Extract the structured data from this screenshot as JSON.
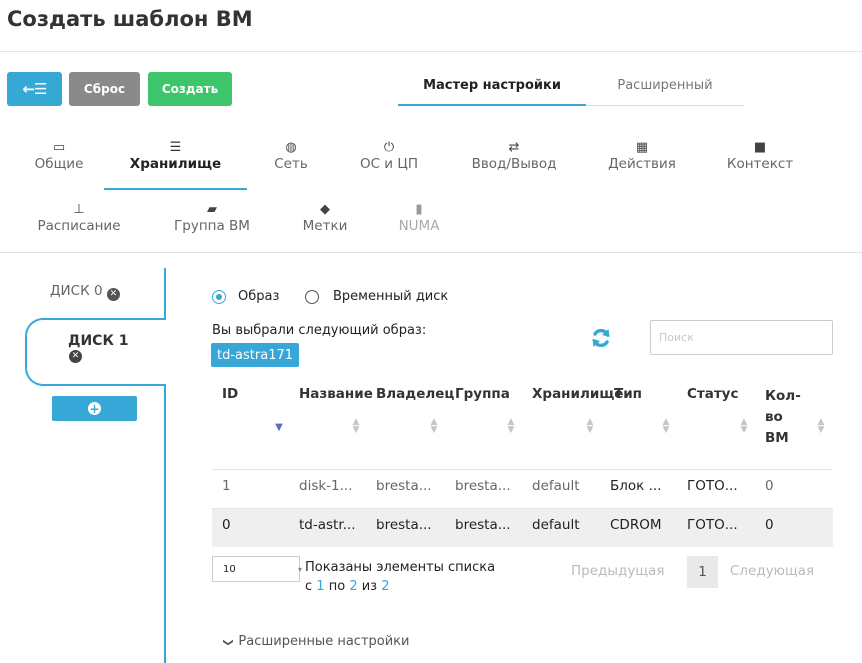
{
  "page_title": "Создать шаблон ВМ",
  "toolbar": {
    "back_icon": "arrow-left-list-icon",
    "back_glyph": "←☰",
    "reset_label": "Сброс",
    "create_label": "Создать"
  },
  "mode_tabs": {
    "wizard": "Мастер настройки",
    "advanced": "Расширенный"
  },
  "section_tabs": [
    {
      "label": "Общие",
      "icon": "laptop-icon",
      "glyph": "▭"
    },
    {
      "label": "Хранилище",
      "icon": "storage-icon",
      "glyph": "☰"
    },
    {
      "label": "Сеть",
      "icon": "globe-icon",
      "glyph": "◍"
    },
    {
      "label": "ОС и ЦП",
      "icon": "power-icon",
      "glyph": "⏻"
    },
    {
      "label": "Ввод/Вывод",
      "icon": "exchange-icon",
      "glyph": "⇄"
    },
    {
      "label": "Действия",
      "icon": "calendar-icon",
      "glyph": "▦"
    },
    {
      "label": "Контекст",
      "icon": "folder-icon",
      "glyph": "■"
    },
    {
      "label": "Расписание",
      "icon": "sitemap-icon",
      "glyph": "⊥"
    },
    {
      "label": "Группа ВМ",
      "icon": "folder-open-icon",
      "glyph": "▰"
    },
    {
      "label": "Метки",
      "icon": "tag-icon",
      "glyph": "◆"
    },
    {
      "label": "NUMA",
      "icon": "chip-icon",
      "glyph": "▮"
    }
  ],
  "disks": {
    "disk0": "ДИСК 0",
    "disk1": "ДИСК 1"
  },
  "source": {
    "image_label": "Образ",
    "volatile_label": "Временный диск",
    "selected_text": "Вы выбрали следующий образ:",
    "selected_image": "td-astra171",
    "search_placeholder": "Поиск"
  },
  "table": {
    "headers": [
      "ID",
      "Название",
      "Владелец",
      "Группа",
      "Хранилище",
      "Тип",
      "Статус",
      "Кол-во ВМ"
    ],
    "header_kolvo": [
      "Кол-",
      "во",
      "ВМ"
    ],
    "rows": [
      [
        "1",
        "disk-1...",
        "bresta...",
        "bresta...",
        "default",
        "Блок ...",
        "ГОТО...",
        "0"
      ],
      [
        "0",
        "td-astr...",
        "bresta...",
        "bresta...",
        "default",
        "CDROM",
        "ГОТО...",
        "0"
      ]
    ]
  },
  "pagination": {
    "page_size": "10",
    "shown_line1": "Показаны элементы списка",
    "shown_prefix": "с",
    "from": "1",
    "by": "по",
    "to": "2",
    "of": "из",
    "total": "2",
    "prev": "Предыдущая",
    "current": "1",
    "next": "Следующая"
  },
  "advanced_settings": "Расширенные настройки",
  "colors": {
    "accent": "#37a7d8",
    "reset": "#8a8a8a",
    "create": "#3ec56c"
  }
}
